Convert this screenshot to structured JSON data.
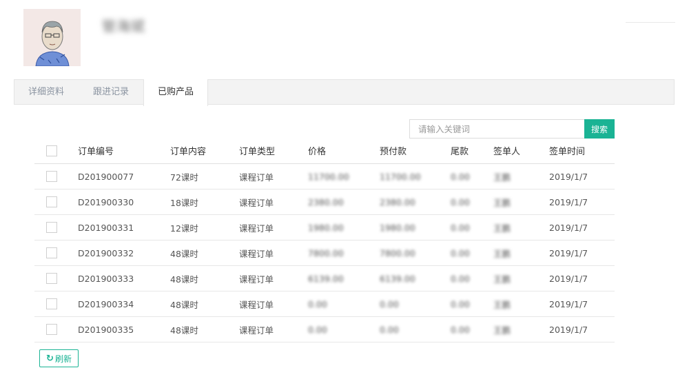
{
  "profile": {
    "name": "管海斌"
  },
  "tabs": [
    {
      "label": "详细资料",
      "active": false
    },
    {
      "label": "跟进记录",
      "active": false
    },
    {
      "label": "已购产品",
      "active": true
    }
  ],
  "search": {
    "placeholder": "请输入关键词",
    "button_label": "搜索"
  },
  "table": {
    "headers": [
      "订单编号",
      "订单内容",
      "订单类型",
      "价格",
      "预付款",
      "尾款",
      "签单人",
      "签单时间"
    ],
    "rows": [
      {
        "order_no": "D201900077",
        "content": "72课时",
        "type": "课程订单",
        "price": "11700.00",
        "prepaid": "11700.00",
        "balance": "0.00",
        "signer": "王鹏",
        "date": "2019/1/7"
      },
      {
        "order_no": "D201900330",
        "content": "18课时",
        "type": "课程订单",
        "price": "2380.00",
        "prepaid": "2380.00",
        "balance": "0.00",
        "signer": "王鹏",
        "date": "2019/1/7"
      },
      {
        "order_no": "D201900331",
        "content": "12课时",
        "type": "课程订单",
        "price": "1980.00",
        "prepaid": "1980.00",
        "balance": "0.00",
        "signer": "王鹏",
        "date": "2019/1/7"
      },
      {
        "order_no": "D201900332",
        "content": "48课时",
        "type": "课程订单",
        "price": "7800.00",
        "prepaid": "7800.00",
        "balance": "0.00",
        "signer": "王鹏",
        "date": "2019/1/7"
      },
      {
        "order_no": "D201900333",
        "content": "48课时",
        "type": "课程订单",
        "price": "6139.00",
        "prepaid": "6139.00",
        "balance": "0.00",
        "signer": "王鹏",
        "date": "2019/1/7"
      },
      {
        "order_no": "D201900334",
        "content": "48课时",
        "type": "课程订单",
        "price": "0.00",
        "prepaid": "0.00",
        "balance": "0.00",
        "signer": "王鹏",
        "date": "2019/1/7"
      },
      {
        "order_no": "D201900335",
        "content": "48课时",
        "type": "课程订单",
        "price": "0.00",
        "prepaid": "0.00",
        "balance": "0.00",
        "signer": "王鹏",
        "date": "2019/1/7"
      }
    ]
  },
  "refresh": {
    "icon": "refresh-icon",
    "label": "刷新"
  },
  "colors": {
    "accent": "#1ab394",
    "tab_bar_bg": "#f3f3f3"
  }
}
